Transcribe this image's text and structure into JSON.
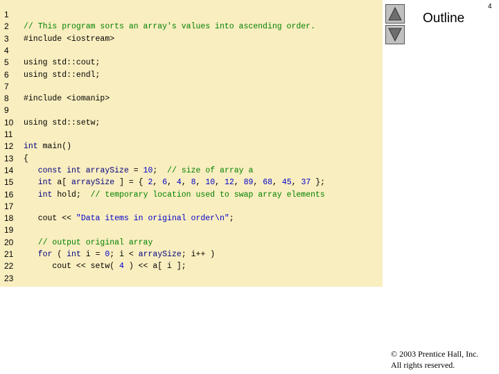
{
  "page": {
    "number": "4",
    "outline_label": "Outline"
  },
  "nav": {
    "up_icon": "triangle-up-icon",
    "down_icon": "triangle-down-icon"
  },
  "footer": {
    "copyright_line1": "© 2003 Prentice Hall, Inc.",
    "copyright_line2": "All rights reserved."
  },
  "code_lines": [
    {
      "n": "1",
      "segs": []
    },
    {
      "n": "2",
      "segs": [
        [
          "cm",
          "// This program sorts an array's values into ascending order."
        ]
      ]
    },
    {
      "n": "3",
      "segs": [
        [
          "pl",
          "#include <iostream>"
        ]
      ]
    },
    {
      "n": "4",
      "segs": []
    },
    {
      "n": "5",
      "segs": [
        [
          "pl",
          "using std::cout;"
        ]
      ]
    },
    {
      "n": "6",
      "segs": [
        [
          "pl",
          "using std::endl;"
        ]
      ]
    },
    {
      "n": "7",
      "segs": []
    },
    {
      "n": "8",
      "segs": [
        [
          "pl",
          "#include <iomanip>"
        ]
      ]
    },
    {
      "n": "9",
      "segs": []
    },
    {
      "n": "10",
      "segs": [
        [
          "pl",
          "using std::setw;"
        ]
      ]
    },
    {
      "n": "11",
      "segs": []
    },
    {
      "n": "12",
      "segs": [
        [
          "kw",
          "int"
        ],
        [
          "pl",
          " main()"
        ]
      ]
    },
    {
      "n": "13",
      "segs": [
        [
          "pl",
          "{"
        ]
      ]
    },
    {
      "n": "14",
      "segs": [
        [
          "pl",
          "   "
        ],
        [
          "kw",
          "const int"
        ],
        [
          "pl",
          " "
        ],
        [
          "kw",
          "arraySize"
        ],
        [
          "pl",
          " = "
        ],
        [
          "num",
          "10"
        ],
        [
          "pl",
          ";  "
        ],
        [
          "cm",
          "// size of array a"
        ]
      ]
    },
    {
      "n": "15",
      "segs": [
        [
          "pl",
          "   "
        ],
        [
          "kw",
          "int"
        ],
        [
          "pl",
          " a[ "
        ],
        [
          "kw",
          "arraySize"
        ],
        [
          "pl",
          " ] = { "
        ],
        [
          "num",
          "2"
        ],
        [
          "pl",
          ", "
        ],
        [
          "num",
          "6"
        ],
        [
          "pl",
          ", "
        ],
        [
          "num",
          "4"
        ],
        [
          "pl",
          ", "
        ],
        [
          "num",
          "8"
        ],
        [
          "pl",
          ", "
        ],
        [
          "num",
          "10"
        ],
        [
          "pl",
          ", "
        ],
        [
          "num",
          "12"
        ],
        [
          "pl",
          ", "
        ],
        [
          "num",
          "89"
        ],
        [
          "pl",
          ", "
        ],
        [
          "num",
          "68"
        ],
        [
          "pl",
          ", "
        ],
        [
          "num",
          "45"
        ],
        [
          "pl",
          ", "
        ],
        [
          "num",
          "37"
        ],
        [
          "pl",
          " };"
        ]
      ]
    },
    {
      "n": "16",
      "segs": [
        [
          "pl",
          "   "
        ],
        [
          "kw",
          "int"
        ],
        [
          "pl",
          " hold;  "
        ],
        [
          "cm",
          "// temporary location used to swap array elements"
        ]
      ]
    },
    {
      "n": "17",
      "segs": []
    },
    {
      "n": "18",
      "segs": [
        [
          "pl",
          "   cout << "
        ],
        [
          "str",
          "\"Data items in original order\\n\""
        ],
        [
          "pl",
          ";"
        ]
      ]
    },
    {
      "n": "19",
      "segs": []
    },
    {
      "n": "20",
      "segs": [
        [
          "pl",
          "   "
        ],
        [
          "cm",
          "// output original array"
        ]
      ]
    },
    {
      "n": "21",
      "segs": [
        [
          "pl",
          "   "
        ],
        [
          "kw",
          "for"
        ],
        [
          "pl",
          " ( "
        ],
        [
          "kw",
          "int"
        ],
        [
          "pl",
          " i = "
        ],
        [
          "num",
          "0"
        ],
        [
          "pl",
          "; i < "
        ],
        [
          "kw",
          "arraySize"
        ],
        [
          "pl",
          "; i++ )"
        ]
      ]
    },
    {
      "n": "22",
      "segs": [
        [
          "pl",
          "      cout << setw( "
        ],
        [
          "num",
          "4"
        ],
        [
          "pl",
          " ) << a[ i ];"
        ]
      ]
    },
    {
      "n": "23",
      "segs": []
    }
  ]
}
